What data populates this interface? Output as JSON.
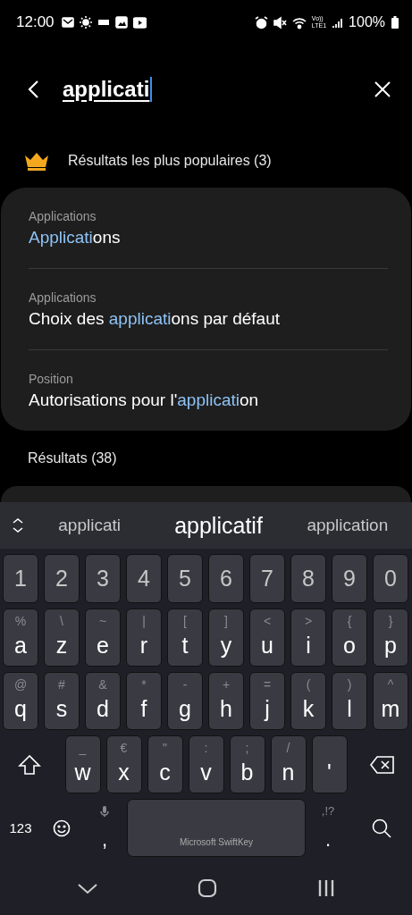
{
  "status_bar": {
    "time": "12:00",
    "volte": "Vo))",
    "network": "LTE1",
    "battery": "100%"
  },
  "search": {
    "value": "applicati"
  },
  "popular": {
    "heading": "Résultats les plus populaires (3)",
    "items": [
      {
        "category": "Applications",
        "match": "Applicati",
        "after": "ons"
      },
      {
        "category": "Applications",
        "before": "Choix des ",
        "match": "applicati",
        "after": "ons par défaut"
      },
      {
        "category": "Position",
        "before": "Autorisations pour l'",
        "match": "applicati",
        "after": "on"
      }
    ]
  },
  "results": {
    "heading": "Résultats (38)"
  },
  "keyboard": {
    "suggestions": [
      {
        "text": "applicati",
        "selected": false
      },
      {
        "text": "applicatif",
        "selected": true
      },
      {
        "text": "application",
        "selected": false
      }
    ],
    "number_row": [
      "1",
      "2",
      "3",
      "4",
      "5",
      "6",
      "7",
      "8",
      "9",
      "0"
    ],
    "rows": [
      [
        {
          "key": "a",
          "hint": "%"
        },
        {
          "key": "z",
          "hint": "\\"
        },
        {
          "key": "e",
          "hint": "~"
        },
        {
          "key": "r",
          "hint": "|"
        },
        {
          "key": "t",
          "hint": "["
        },
        {
          "key": "y",
          "hint": "]"
        },
        {
          "key": "u",
          "hint": "<"
        },
        {
          "key": "i",
          "hint": ">"
        },
        {
          "key": "o",
          "hint": "{"
        },
        {
          "key": "p",
          "hint": "}"
        }
      ],
      [
        {
          "key": "q",
          "hint": "@"
        },
        {
          "key": "s",
          "hint": "#"
        },
        {
          "key": "d",
          "hint": "&"
        },
        {
          "key": "f",
          "hint": "*"
        },
        {
          "key": "g",
          "hint": "-"
        },
        {
          "key": "h",
          "hint": "+"
        },
        {
          "key": "j",
          "hint": "="
        },
        {
          "key": "k",
          "hint": "("
        },
        {
          "key": "l",
          "hint": ")"
        },
        {
          "key": "m",
          "hint": "^"
        }
      ],
      [
        {
          "key": "w",
          "hint": "_"
        },
        {
          "key": "x",
          "hint": "€"
        },
        {
          "key": "c",
          "hint": "\""
        },
        {
          "key": "v",
          "hint": ":"
        },
        {
          "key": "b",
          "hint": ";"
        },
        {
          "key": "n",
          "hint": "/"
        },
        {
          "key": "'"
        }
      ]
    ],
    "numbers_key": "123",
    "comma": ",",
    "space": "Microsoft SwiftKey",
    "period": ".",
    "period_hint": ",!?"
  }
}
